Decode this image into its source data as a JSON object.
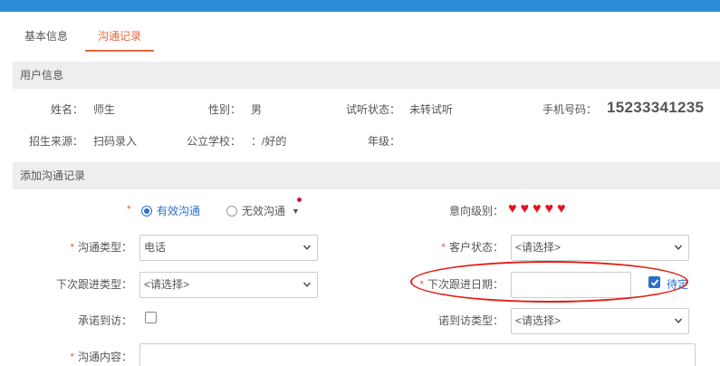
{
  "tabs": [
    {
      "label": "基本信息",
      "active": false
    },
    {
      "label": "沟通记录",
      "active": true
    }
  ],
  "user_info": {
    "section_title": "用户信息",
    "name_label": "姓名：",
    "name": "师生",
    "gender_label": "性别：",
    "gender": "男",
    "trial_label": "试听状态：",
    "trial": "未转试听",
    "phone_label": "手机号码：",
    "phone": "15233341235",
    "source_label": "招生来源：",
    "source": "扫码录入",
    "school_label": "公立学校：",
    "school": "：/好的",
    "grade_label": "年级：",
    "grade": ""
  },
  "add_record": {
    "section_title": "添加沟通记录",
    "required_mark": "*",
    "valid_label": "有效沟通",
    "invalid_label": "无效沟通",
    "selected": "有效沟通",
    "intent_label": "意向级别：",
    "intent_hearts": 5,
    "comm_type_label": "沟通类型：",
    "comm_type_value": "电话",
    "customer_status_label": "客户状态：",
    "customer_status_value": "<请选择>",
    "followup_type_label": "下次跟进类型：",
    "followup_type_value": "<请选择>",
    "followup_date_label": "下次跟进日期：",
    "followup_date_value": "",
    "pending_label": "待定",
    "pending_checked": true,
    "promise_label": "承诺到访：",
    "promise_checked": false,
    "visit_type_label": "诺到访类型：",
    "visit_type_value": "<请选择>",
    "content_label": "沟通内容：",
    "content_value": ""
  },
  "colors": {
    "topbar": "#2d8cd7",
    "accent": "#e8663d",
    "radio": "#2d6fcc",
    "heart": "#e8101e",
    "annotation": "#e0201a"
  }
}
